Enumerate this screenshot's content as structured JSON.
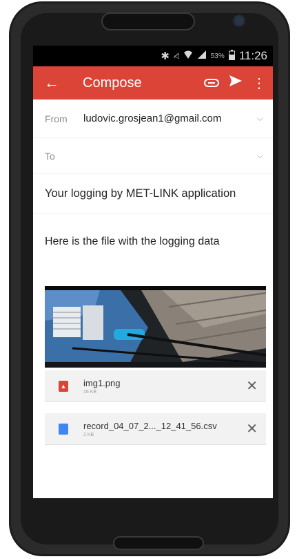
{
  "status_bar": {
    "icons": [
      "bluetooth-icon",
      "mute-icon",
      "wifi-icon",
      "signal-icon",
      "battery-icon"
    ],
    "battery": "53%",
    "time": "11:26"
  },
  "app_bar": {
    "back": "←",
    "title": "Compose",
    "color": "#db4437"
  },
  "from": {
    "label": "From",
    "value": "ludovic.grosjean1@gmail.com"
  },
  "to": {
    "label": "To",
    "value": ""
  },
  "subject": "Your logging by MET-LINK application",
  "body": "Here is the file with the logging data",
  "attachments": [
    {
      "name": "img1.png",
      "size": "16 KB",
      "icon": "image-file-icon",
      "color": "#db4437"
    },
    {
      "name": "record_04_07_2..._12_41_56.csv",
      "size": "2 KB",
      "icon": "document-file-icon",
      "color": "#4285f4"
    }
  ]
}
